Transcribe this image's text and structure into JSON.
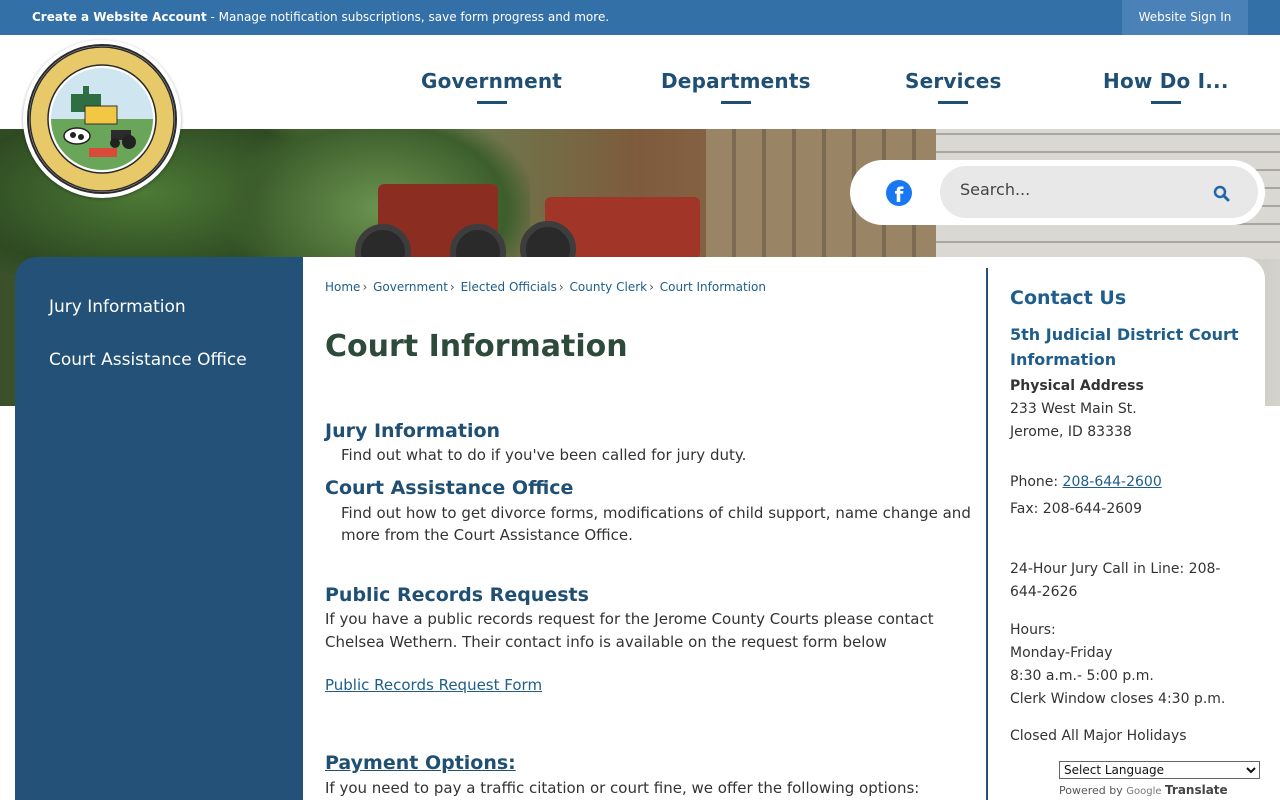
{
  "topbar": {
    "account_bold": "Create a Website Account",
    "account_rest": " - Manage notification subscriptions, save form progress and more.",
    "signin": "Website Sign In"
  },
  "nav": [
    "Government",
    "Departments",
    "Services",
    "How Do I..."
  ],
  "search": {
    "placeholder": "Search..."
  },
  "social": {
    "facebook": "f"
  },
  "sidebar": {
    "items": [
      "Jury Information",
      "Court Assistance Office"
    ]
  },
  "breadcrumb": [
    "Home",
    "Government",
    "Elected Officials",
    "County Clerk",
    "Court Information"
  ],
  "main": {
    "title": "Court Information",
    "sections": [
      {
        "heading": "Jury Information",
        "text": "Find out what to do if you've been called for jury duty."
      },
      {
        "heading": "Court Assistance Office",
        "text": "Find out how to get divorce forms, modifications of child support, name change and more from the Court Assistance Office."
      }
    ],
    "records_heading": "Public Records Requests",
    "records_text": "If you have a public records request for the Jerome County Courts please contact Chelsea Wethern. Their contact info is available on the request form below",
    "records_link": "Public Records Request Form",
    "payment_heading": "Payment Options:",
    "payment_text": "If you need to pay a traffic citation or court fine, we offer the following options:"
  },
  "contact": {
    "heading": "Contact Us",
    "court_name": "5th Judicial District Court Information",
    "address_label": "Physical Address",
    "address_line1": "233 West Main St.",
    "address_line2": "Jerome, ID 83338",
    "phone_label": "Phone: ",
    "phone": "208-644-2600",
    "fax": "Fax: 208-644-2609",
    "jury_line": "24-Hour Jury Call in Line: 208-644-2626",
    "hours_label": "Hours:",
    "hours_days": "Monday-Friday",
    "hours_time": "8:30 a.m.- 5:00 p.m.",
    "clerk_window": "Clerk Window closes 4:30 p.m.",
    "holidays": "Closed All Major Holidays"
  },
  "translate": {
    "select": "Select Language",
    "powered": "Powered by",
    "google": "Google",
    "translate": "Translate"
  },
  "colors": {
    "topbar": "#3470a8",
    "nav_text": "#1f4f73",
    "sidebar": "#235177",
    "link": "#1f5d8c",
    "title": "#2e4a3b",
    "facebook": "#1877f2"
  }
}
